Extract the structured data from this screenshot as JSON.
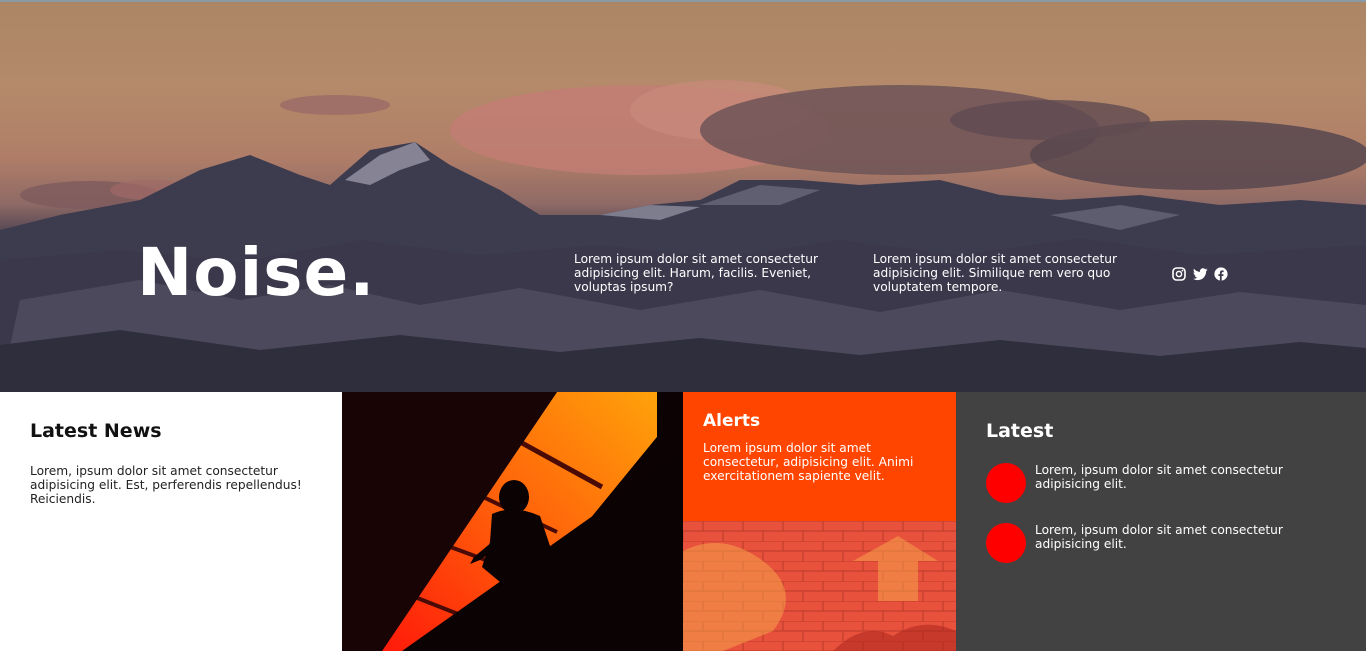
{
  "hero": {
    "brand": "Noise.",
    "text_1": "Lorem ipsum dolor sit amet consectetur adipisicing elit. Harum, facilis. Eveniet, voluptas ipsum?",
    "text_2": "Lorem ipsum dolor sit amet consectetur adipisicing elit. Similique rem vero quo voluptatem tempore.",
    "social_icons": [
      "instagram-icon",
      "twitter-icon",
      "facebook-icon"
    ]
  },
  "news": {
    "title": "Latest News",
    "body": "Lorem, ipsum dolor sit amet consectetur adipisicing elit. Est, perferendis repellendus! Reiciendis."
  },
  "alerts": {
    "title": "Alerts",
    "body": "Lorem ipsum dolor sit amet consectetur, adipisicing elit. Animi exercitationem sapiente velit."
  },
  "latest": {
    "title": "Latest",
    "items": [
      {
        "text": "Lorem, ipsum dolor sit amet consectetur adipisicing elit."
      },
      {
        "text": "Lorem, ipsum dolor sit amet consectetur adipisicing elit."
      }
    ]
  },
  "colors": {
    "alert_bg": "#ff4500",
    "latest_bg": "#424242",
    "dot": "#ff0000"
  }
}
